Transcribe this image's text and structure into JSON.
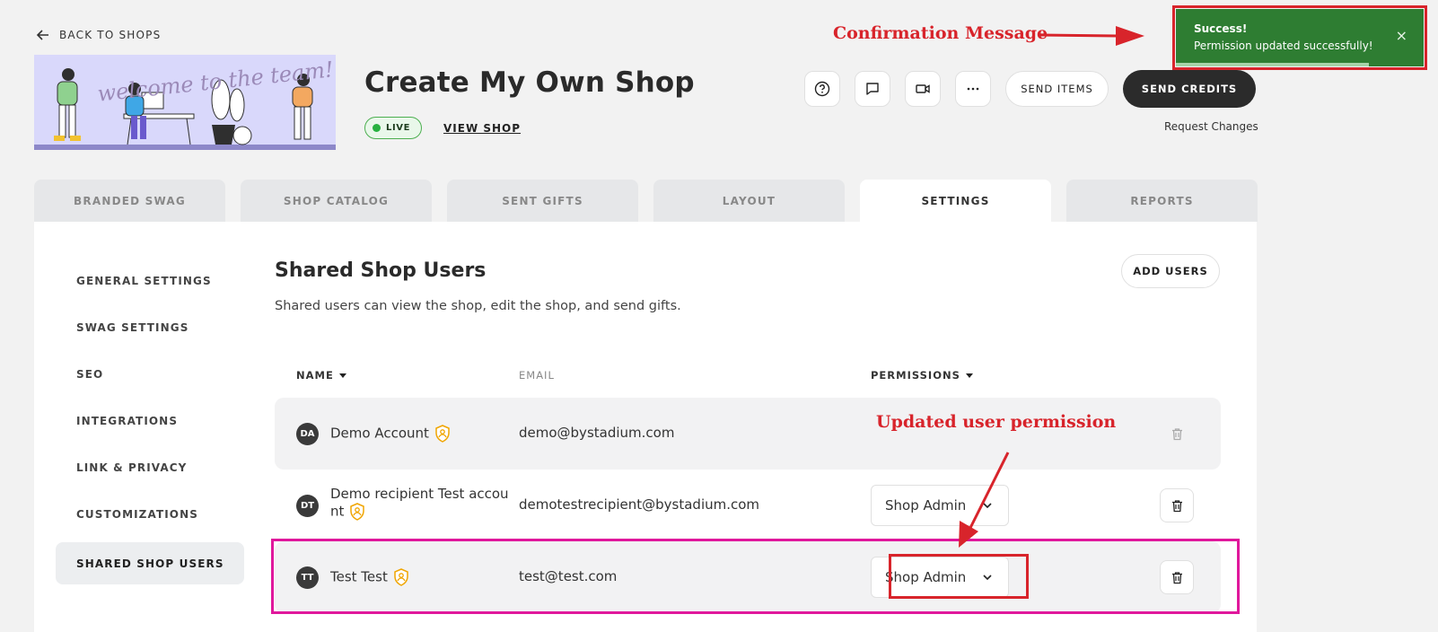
{
  "nav": {
    "back_label": "BACK TO SHOPS"
  },
  "banner": {
    "script_text": "welcome to the team!"
  },
  "shop": {
    "title": "Create My Own Shop",
    "status": "LIVE",
    "view_shop_label": "VIEW SHOP"
  },
  "actions": {
    "send_items": "SEND ITEMS",
    "send_credits": "SEND CREDITS",
    "request_changes": "Request Changes"
  },
  "toast": {
    "title": "Success!",
    "message": "Permission updated successfully!",
    "close": "×",
    "color": "#2e7d32"
  },
  "annotations": {
    "confirmation": "Confirmation Message",
    "updated": "Updated user permission",
    "color": "#d8242b",
    "highlight_color": "#e0189c"
  },
  "tabs": [
    {
      "label": "BRANDED SWAG"
    },
    {
      "label": "SHOP CATALOG"
    },
    {
      "label": "SENT GIFTS"
    },
    {
      "label": "LAYOUT"
    },
    {
      "label": "SETTINGS"
    },
    {
      "label": "REPORTS"
    }
  ],
  "sidebar": {
    "items": [
      {
        "label": "GENERAL SETTINGS"
      },
      {
        "label": "SWAG SETTINGS"
      },
      {
        "label": "SEO"
      },
      {
        "label": "INTEGRATIONS"
      },
      {
        "label": "LINK & PRIVACY"
      },
      {
        "label": "CUSTOMIZATIONS"
      },
      {
        "label": "SHARED SHOP USERS"
      }
    ]
  },
  "main": {
    "title": "Shared Shop Users",
    "description": "Shared users can view the shop, edit the shop, and send gifts.",
    "add_users": "ADD USERS",
    "columns": {
      "name": "NAME",
      "email": "EMAIL",
      "permissions": "PERMISSIONS"
    },
    "rows": [
      {
        "initials": "DA",
        "name": "Demo Account",
        "email": "demo@bystadium.com",
        "permission": ""
      },
      {
        "initials": "DT",
        "name_line1": "Demo recipient Test accou",
        "name_line2": "nt",
        "email": "demotestrecipient@bystadium.com",
        "permission": "Shop Admin"
      },
      {
        "initials": "TT",
        "name": "Test Test",
        "email": "test@test.com",
        "permission": "Shop Admin"
      }
    ]
  }
}
